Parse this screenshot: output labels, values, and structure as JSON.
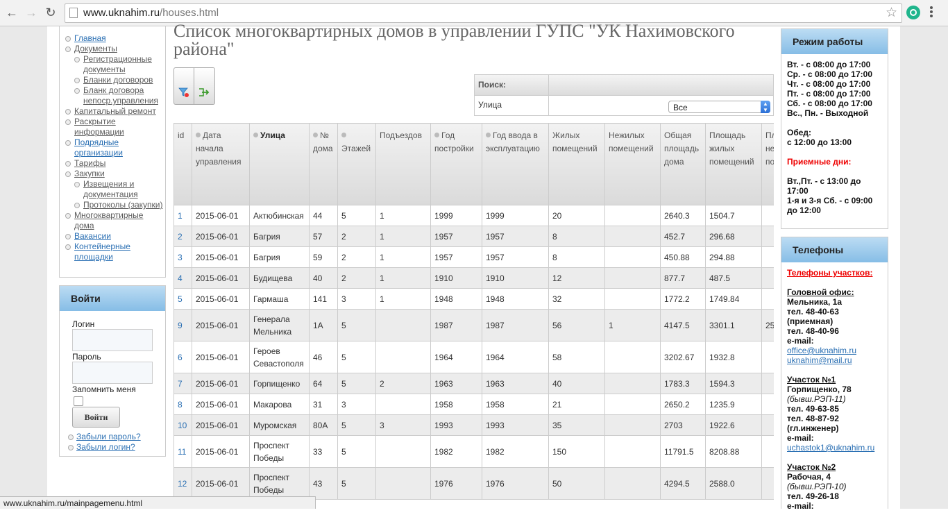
{
  "browser": {
    "url_host": "www.uknahim.ru",
    "url_path": "/houses.html",
    "status_url": "www.uknahim.ru/mainpagemenu.html"
  },
  "page_title": "Список многоквартирных домов в управлении ГУПС \"УК Нахимовского района\"",
  "left_menu": [
    {
      "label": "Главная",
      "level": 0,
      "link": true
    },
    {
      "label": "Документы",
      "level": 0
    },
    {
      "label": "Регистрационные документы",
      "level": 1
    },
    {
      "label": "Бланки договоров",
      "level": 1
    },
    {
      "label": "Бланк договора непоср.управления",
      "level": 1
    },
    {
      "label": "Капитальный ремонт",
      "level": 0
    },
    {
      "label": "Раскрытие информации",
      "level": 0
    },
    {
      "label": "Подрядные организации",
      "level": 0,
      "link": true
    },
    {
      "label": "Тарифы",
      "level": 0
    },
    {
      "label": "Закупки",
      "level": 0
    },
    {
      "label": "Извещения и документация",
      "level": 1
    },
    {
      "label": "Протоколы (закупки)",
      "level": 1
    },
    {
      "label": "Многоквартирные дома",
      "level": 0
    },
    {
      "label": "Вакансии",
      "level": 0,
      "link": true
    },
    {
      "label": "Контейнерные площадки",
      "level": 0,
      "link": true
    }
  ],
  "login": {
    "title": "Войти",
    "login_label": "Логин",
    "password_label": "Пароль",
    "remember_label": "Запомнить меня",
    "submit_label": "Войти",
    "forgot_password": "Забыли пароль?",
    "forgot_login": "Забыли логин?"
  },
  "search": {
    "header": "Поиск:",
    "street_label": "Улица",
    "street_value": "Все"
  },
  "table": {
    "columns": [
      "id",
      "Дата начала управления",
      "Улица",
      "№ дома",
      "Этажей",
      "Подъездов",
      "Год постройки",
      "Год ввода в эксплуатацию",
      "Жилых помещений",
      "Нежилых помещений",
      "Общая площадь дома",
      "Площадь жилых помещений",
      "Пл не по"
    ],
    "rows": [
      [
        "1",
        "2015-06-01",
        "Актюбинская",
        "44",
        "5",
        "1",
        "1999",
        "1999",
        "20",
        "",
        "2640.3",
        "1504.7",
        ""
      ],
      [
        "2",
        "2015-06-01",
        "Багрия",
        "57",
        "2",
        "1",
        "1957",
        "1957",
        "8",
        "",
        "452.7",
        "296.68",
        ""
      ],
      [
        "3",
        "2015-06-01",
        "Багрия",
        "59",
        "2",
        "1",
        "1957",
        "1957",
        "8",
        "",
        "450.88",
        "294.88",
        ""
      ],
      [
        "4",
        "2015-06-01",
        "Будищева",
        "40",
        "2",
        "1",
        "1910",
        "1910",
        "12",
        "",
        "877.7",
        "487.5",
        ""
      ],
      [
        "5",
        "2015-06-01",
        "Гармаша",
        "141",
        "3",
        "1",
        "1948",
        "1948",
        "32",
        "",
        "1772.2",
        "1749.84",
        ""
      ],
      [
        "9",
        "2015-06-01",
        "Генерала Мельника",
        "1А",
        "5",
        "",
        "1987",
        "1987",
        "56",
        "1",
        "4147.5",
        "3301.1",
        "25"
      ],
      [
        "6",
        "2015-06-01",
        "Героев Севастополя",
        "46",
        "5",
        "",
        "1964",
        "1964",
        "58",
        "",
        "3202.67",
        "1932.8",
        ""
      ],
      [
        "7",
        "2015-06-01",
        "Горпищенко",
        "64",
        "5",
        "2",
        "1963",
        "1963",
        "40",
        "",
        "1783.3",
        "1594.3",
        ""
      ],
      [
        "8",
        "2015-06-01",
        "Макарова",
        "31",
        "3",
        "",
        "1958",
        "1958",
        "21",
        "",
        "2650.2",
        "1235.9",
        ""
      ],
      [
        "10",
        "2015-06-01",
        "Муромская",
        "80А",
        "5",
        "3",
        "1993",
        "1993",
        "35",
        "",
        "2703",
        "1922.6",
        ""
      ],
      [
        "11",
        "2015-06-01",
        "Проспект Победы",
        "33",
        "5",
        "",
        "1982",
        "1982",
        "150",
        "",
        "11791.5",
        "8208.88",
        ""
      ],
      [
        "12",
        "2015-06-01",
        "Проспект Победы",
        "43",
        "5",
        "",
        "1976",
        "1976",
        "50",
        "",
        "4294.5",
        "2588.0",
        ""
      ]
    ]
  },
  "schedule": {
    "title": "Режим работы",
    "lines": [
      "Вт. - с 08:00 до 17:00",
      "Ср. - с 08:00 до 17:00",
      "Чт. - с 08:00 до 17:00",
      "Пт. - с 08:00 до 17:00",
      "Сб. - с 08:00 до 17:00",
      "Вс., Пн. - Выходной"
    ],
    "lunch_label": "Обед:",
    "lunch_time": "с 12:00 до 13:00",
    "reception_label": "Приемные дни:",
    "reception_1": "Вт.,Пт. - с 13:00 до 17:00",
    "reception_2": "1-я и 3-я Сб. - с 09:00 до 12:00"
  },
  "phones": {
    "title": "Телефоны",
    "sites_link": "Телефоны участков:",
    "head_office": "Головной офис:",
    "ho_address": "Мельника, 1а",
    "ho_tel1": "тел. 48-40-63",
    "ho_tel1_note": "(приемная)",
    "ho_tel2": "тел. 48-40-96",
    "email_label": "e-mail:",
    "ho_email1": "office@uknahim.ru",
    "ho_email2": "uknahim@mail.ru",
    "s1_title": "Участок №1",
    "s1_address": "Горпищенко, 78",
    "s1_note": "(бывш.РЭП-11)",
    "s1_tel1": "тел. 49-63-85",
    "s1_tel2": "тел. 48-87-92",
    "s1_tel2_note": "(гл.инженер)",
    "s1_email": "uchastok1@uknahim.ru",
    "s2_title": "Участок №2",
    "s2_address": "Рабочая, 4",
    "s2_note": "(бывш.РЭП-10)",
    "s2_tel1": "тел. 49-26-18"
  }
}
